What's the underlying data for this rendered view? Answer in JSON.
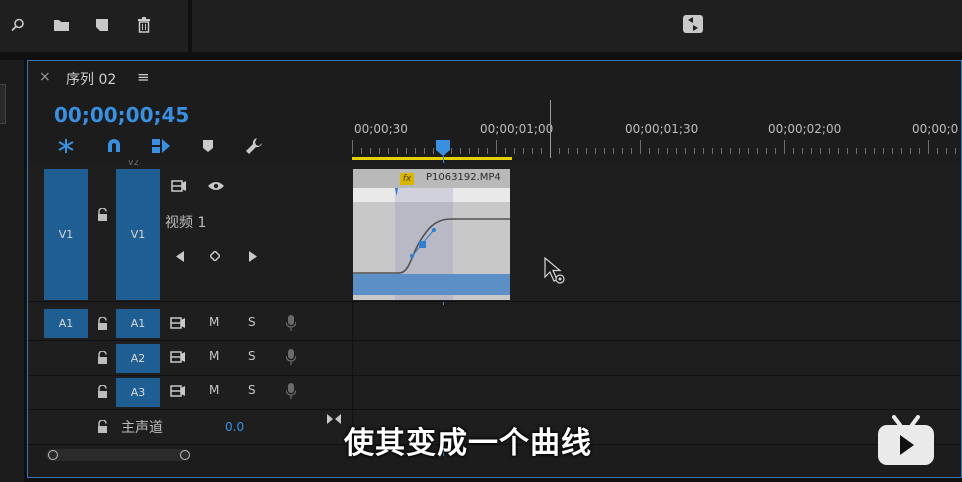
{
  "panel_title": "序列 02",
  "close_symbol": "×",
  "menu_symbol": "≡",
  "timecode": "00;00;00;45",
  "ruler_labels": [
    "00;00;30",
    "00;00;01;00",
    "00;00;01;30",
    "00;00;02;00",
    "00;00;0"
  ],
  "tracks": {
    "v1_source": "V1",
    "v1_target": "V1",
    "v1_name": "视频 1",
    "v1_above": "V2",
    "a1_source": "A1",
    "a1_target": "A1",
    "a2_target": "A2",
    "a3_target": "A3",
    "m": "M",
    "s": "S",
    "master_label": "主声道",
    "master_value": "0.0"
  },
  "clip": {
    "fx": "fx",
    "name": "P1063192.MP4"
  },
  "subtitle": "使其变成一个曲线",
  "colors": {
    "accent": "#3a8fe0",
    "track_blue": "#1f5e93",
    "work_area": "#e7d100",
    "clip_gray": "#c8c8c8"
  }
}
